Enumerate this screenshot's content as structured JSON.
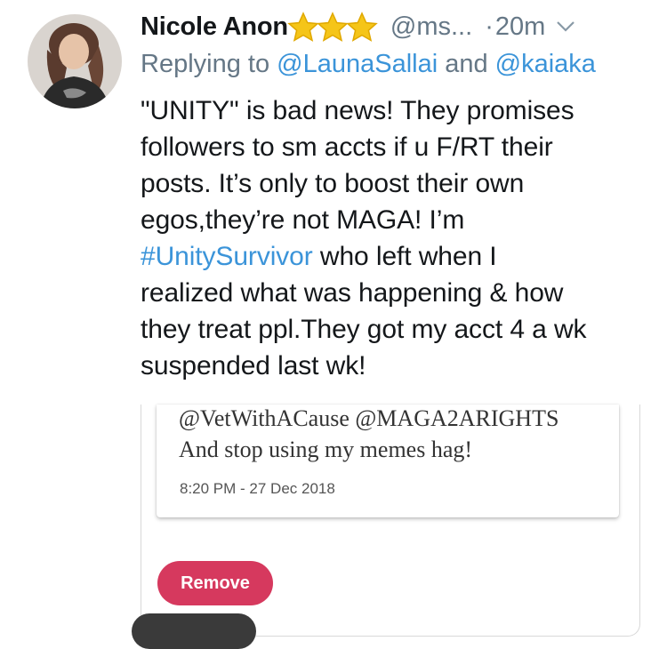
{
  "tweet": {
    "display_name": "Nicole Anon",
    "handle": "@ms...",
    "separator": "·",
    "time": "20m",
    "reply_prefix": "Replying to ",
    "reply_user_1": "@LaunaSallai",
    "reply_and": " and ",
    "reply_user_2": "@kaiaka",
    "lines": {
      "l1": "\"UNITY\" is bad news! They promises",
      "l2": "followers to sm accts if u F/RT their",
      "l3": "posts. It’s only to boost their own",
      "l4": "egos,they’re not MAGA! I’m",
      "hashtag": "#UnitySurvivor",
      "l5_rest": " who left when I",
      "l6": "realized what was happening & how",
      "l7": "they treat ppl.They got my acct 4 a wk",
      "l8": "suspended last wk!"
    }
  },
  "embedded": {
    "line1": "@VetWithACause @MAGA2ARIGHTS",
    "line2": "And stop using my memes hag!",
    "timestamp": "8:20 PM - 27 Dec 2018",
    "remove_label": "Remove"
  },
  "icons": {
    "stars": "star-icon",
    "caret": "chevron-down-icon"
  },
  "colors": {
    "link": "#3b94d9",
    "secondary_text": "#657786",
    "star": "#f5c518",
    "remove_button": "#d6395e"
  }
}
